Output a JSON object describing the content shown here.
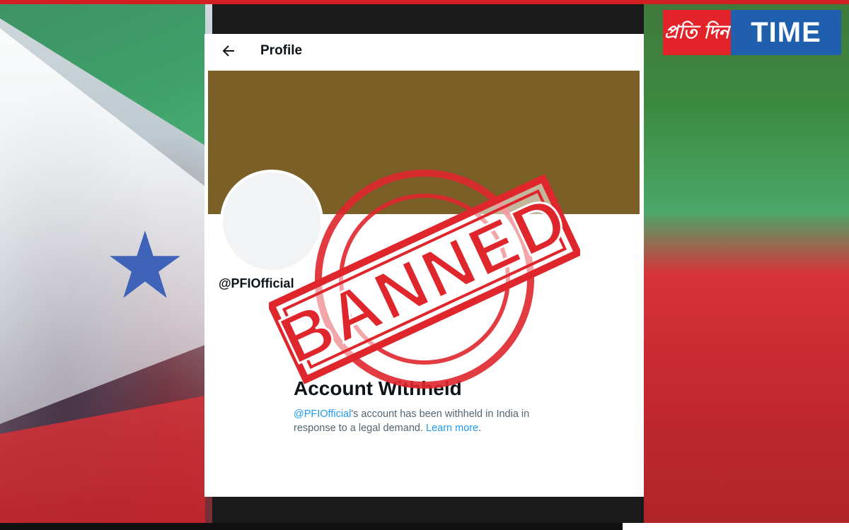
{
  "logo": {
    "bengali_text": "প্রতি দিন",
    "brand_text": "TIME"
  },
  "profile_card": {
    "header_title": "Profile",
    "handle": "@PFIOfficial",
    "withheld_title": "Account Withheld",
    "withheld_handle": "@PFIOfficial",
    "withheld_body": "'s account has been withheld in India in response to a legal demand. ",
    "learn_more": "Learn more",
    "trailing_period": "."
  },
  "stamp": {
    "text": "BANNED",
    "color": "#e0262d"
  },
  "colors": {
    "banner": "#7a6026",
    "link": "#1d9bf0",
    "logo_red": "#e2232a",
    "logo_blue": "#1f5fae"
  },
  "icons": {
    "back": "arrow-left-icon",
    "star": "star-icon"
  }
}
